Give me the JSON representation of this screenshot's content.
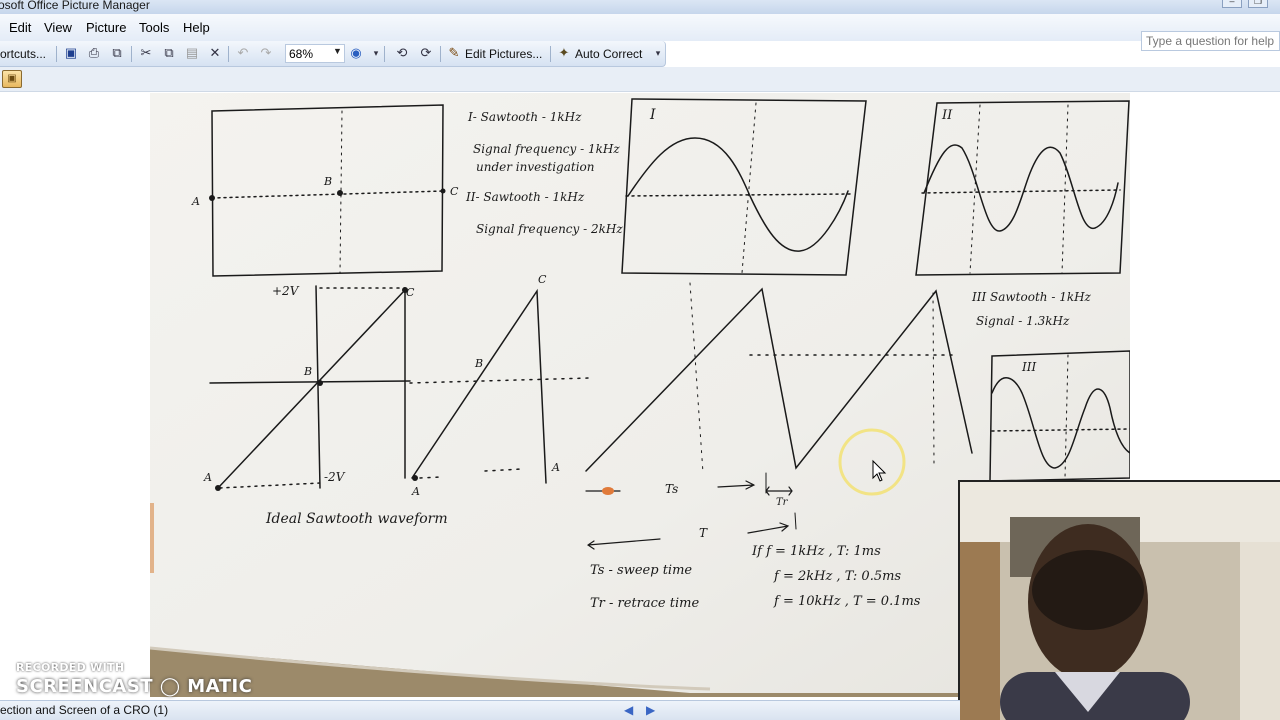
{
  "window": {
    "title": "rosoft Office Picture Manager"
  },
  "menu": {
    "items": [
      "Edit",
      "View",
      "Picture",
      "Tools",
      "Help"
    ],
    "help_placeholder": "Type a question for help"
  },
  "toolbar": {
    "shortcuts_label": "ortcuts...",
    "zoom_value": "68%",
    "edit_pictures_label": "Edit Pictures...",
    "auto_correct_label": "Auto Correct"
  },
  "image_notes": {
    "note_i_1": "I- Sawtooth - 1kHz",
    "note_i_2": "Signal frequency - 1kHz",
    "note_i_3": "under investigation",
    "note_ii_1": "II- Sawtooth - 1kHz",
    "note_ii_2": "Signal frequency - 2kHz",
    "note_iii_1": "III Sawtooth - 1kHz",
    "note_iii_2": "Signal - 1.3kHz",
    "label_I": "I",
    "label_II": "II",
    "label_III": "III",
    "plus2v": "+2V",
    "minus2v": "-2V",
    "pt_A": "A",
    "pt_B": "B",
    "pt_C": "C",
    "ideal": "Ideal Sawtooth waveform",
    "ts_label": "Ts",
    "tr_label": "Tr",
    "t_label": "T",
    "ts_def": "Ts - sweep time",
    "tr_def": "Tr - retrace time",
    "f1": "If  f = 1kHz ,  T: 1ms",
    "f2": "f = 2kHz ,  T:  0.5ms",
    "f3": "f = 10kHz ,  T =   0.1ms"
  },
  "watermark": {
    "line1": "RECORDED WITH",
    "line2": "SCREENCAST ◯ MATIC"
  },
  "status": {
    "filename": "ection and Screen of a CRO (1)"
  }
}
